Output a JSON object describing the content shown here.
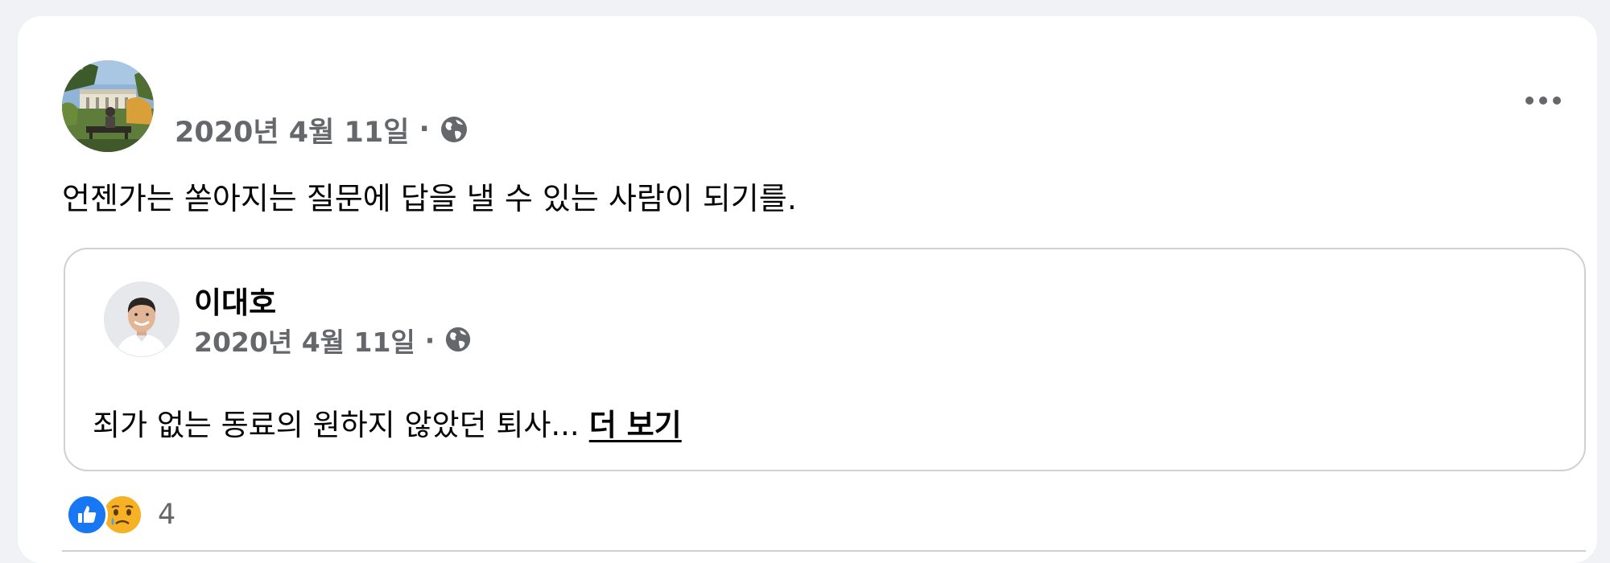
{
  "post": {
    "date": "2020년 4월 11일",
    "separator": "·",
    "privacy_icon": "globe-icon",
    "text": "언젠가는 쏟아지는 질문에 답을 낼 수 있는 사람이 되기를.",
    "more_icon": "more-horizontal-icon"
  },
  "shared_post": {
    "author": "이대호",
    "date": "2020년 4월 11일",
    "separator": "·",
    "privacy_icon": "globe-icon",
    "text": "죄가 없는 동료의 원하지 않았던 퇴사...",
    "see_more": "더 보기"
  },
  "reactions": {
    "icons": [
      "like-icon",
      "sad-icon"
    ],
    "count": "4"
  },
  "colors": {
    "background": "#f0f2f5",
    "card": "#ffffff",
    "meta_text": "#65676b",
    "like_blue": "#1877f2",
    "sad_yellow": "#f7b125",
    "border": "#ced0d4"
  }
}
